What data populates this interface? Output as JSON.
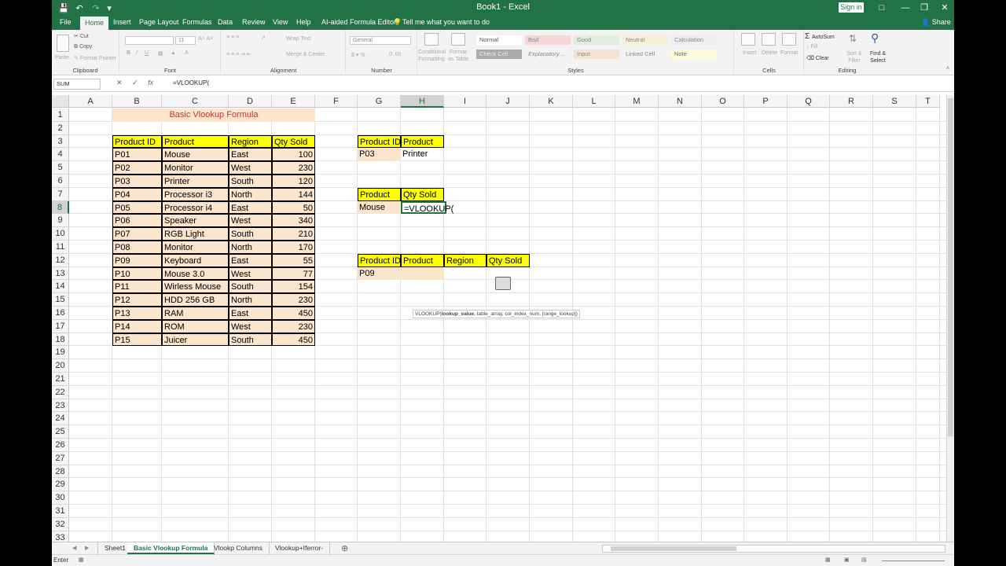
{
  "window": {
    "title": "Book1 - Excel",
    "signin": "Sign in",
    "share": "Share"
  },
  "ribbon": {
    "tabs": [
      "File",
      "Home",
      "Insert",
      "Page Layout",
      "Formulas",
      "Data",
      "Review",
      "View",
      "Help",
      "AI-aided Formula Editor"
    ],
    "active_tab": "Home",
    "tell_me": "Tell me what you want to do",
    "clipboard": {
      "label": "Clipboard",
      "paste": "Paste",
      "cut": "Cut",
      "copy": "Copy",
      "format_painter": "Format Painter"
    },
    "font": {
      "label": "Font",
      "size": "11"
    },
    "alignment": {
      "label": "Alignment",
      "wrap": "Wrap Text",
      "merge": "Merge & Center"
    },
    "number": {
      "label": "Number",
      "format": "General"
    },
    "styles": {
      "label": "Styles",
      "conditional": "Conditional Formatting",
      "format_as_table": "Format as Table",
      "cells": [
        "Normal",
        "Bad",
        "Good",
        "Neutral",
        "Calculation",
        "Check Cell",
        "Explanatory ...",
        "Input",
        "Linked Cell",
        "Note"
      ]
    },
    "cells": {
      "label": "Cells",
      "insert": "Insert",
      "delete": "Delete",
      "format": "Format"
    },
    "editing": {
      "label": "Editing",
      "autosum": "AutoSum",
      "fill": "Fill",
      "clear": "Clear",
      "sort": "Sort & Filter",
      "find": "Find & Select"
    }
  },
  "formula_bar": {
    "name_box": "SUM",
    "formula": "=VLOOKUP("
  },
  "columns": [
    "A",
    "B",
    "C",
    "D",
    "E",
    "F",
    "G",
    "H",
    "I",
    "J",
    "K",
    "L",
    "M",
    "N",
    "O",
    "P",
    "Q",
    "R",
    "S",
    "T"
  ],
  "selected_column": "H",
  "selected_row": "8",
  "rows": [
    "1",
    "2",
    "3",
    "4",
    "5",
    "6",
    "7",
    "8",
    "9",
    "10",
    "11",
    "12",
    "13",
    "14",
    "15",
    "16",
    "17",
    "18",
    "19",
    "20",
    "21",
    "22",
    "23",
    "24",
    "25",
    "26",
    "27",
    "28",
    "29",
    "30",
    "31",
    "32",
    "33"
  ],
  "main_title": "Basic Vlookup Formula",
  "main_table": {
    "headers": [
      "Product  ID",
      "Product",
      "Region",
      "Qty Sold"
    ],
    "rows": [
      [
        "P01",
        "Mouse",
        "East",
        "100"
      ],
      [
        "P02",
        "Monitor",
        "West",
        "230"
      ],
      [
        "P03",
        "Printer",
        "South",
        "120"
      ],
      [
        "P04",
        "Processor i3",
        "North",
        "144"
      ],
      [
        "P05",
        "Processor i4",
        "East",
        "50"
      ],
      [
        "P06",
        "Speaker",
        "West",
        "340"
      ],
      [
        "P07",
        "RGB Light",
        "South",
        "210"
      ],
      [
        "P08",
        "Monitor",
        "North",
        "170"
      ],
      [
        "P09",
        "Keyboard",
        "East",
        "55"
      ],
      [
        "P10",
        "Mouse 3.0",
        "West",
        "77"
      ],
      [
        "P11",
        "Wirless Mouse",
        "South",
        "154"
      ],
      [
        "P12",
        "HDD 256 GB",
        "North",
        "230"
      ],
      [
        "P13",
        "RAM",
        "East",
        "450"
      ],
      [
        "P14",
        "ROM",
        "West",
        "230"
      ],
      [
        "P15",
        "Juicer",
        "South",
        "450"
      ]
    ]
  },
  "lookup1": {
    "headers": [
      "Product  ID",
      "Product"
    ],
    "id": "P03",
    "result": "Printer"
  },
  "lookup2": {
    "headers": [
      "Product",
      "Qty Sold"
    ],
    "value": "Mouse",
    "editing": "=VLOOKUP("
  },
  "lookup3": {
    "headers": [
      "Product  ID",
      "Product",
      "Region",
      "Qty Sold"
    ],
    "id": "P09"
  },
  "tooltip": {
    "fn": "VLOOKUP(",
    "arg1": "lookup_value",
    "rest": ", table_array, col_index_num, [range_lookup])"
  },
  "sheet_tabs": [
    "Sheet1",
    "Basic Vlookup Formula",
    "Vlookp Columns",
    "Vlookup+Iferror-"
  ],
  "active_sheet": "Basic Vlookup Formula",
  "status": {
    "mode": "Enter"
  }
}
